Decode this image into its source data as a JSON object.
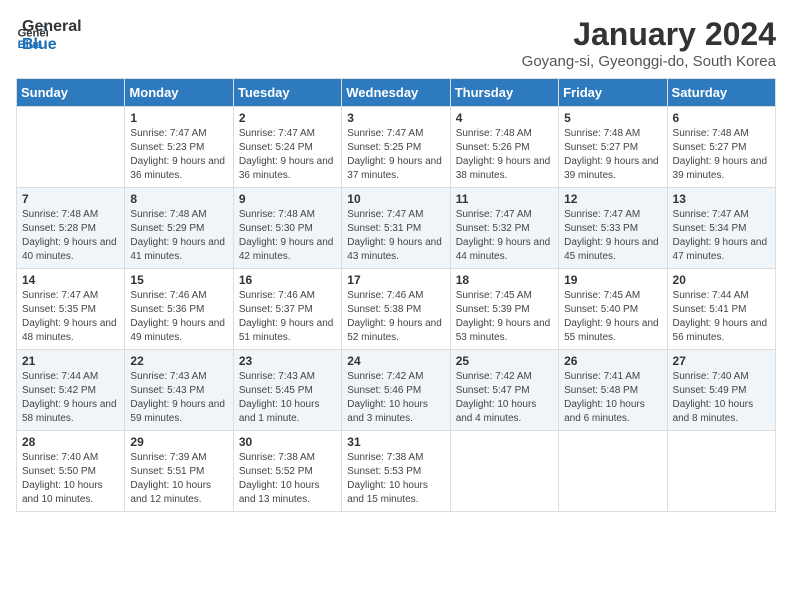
{
  "header": {
    "logo_general": "General",
    "logo_blue": "Blue",
    "month_year": "January 2024",
    "location": "Goyang-si, Gyeonggi-do, South Korea"
  },
  "days_of_week": [
    "Sunday",
    "Monday",
    "Tuesday",
    "Wednesday",
    "Thursday",
    "Friday",
    "Saturday"
  ],
  "weeks": [
    [
      {
        "day": "",
        "sunrise": "",
        "sunset": "",
        "daylight": ""
      },
      {
        "day": "1",
        "sunrise": "Sunrise: 7:47 AM",
        "sunset": "Sunset: 5:23 PM",
        "daylight": "Daylight: 9 hours and 36 minutes."
      },
      {
        "day": "2",
        "sunrise": "Sunrise: 7:47 AM",
        "sunset": "Sunset: 5:24 PM",
        "daylight": "Daylight: 9 hours and 36 minutes."
      },
      {
        "day": "3",
        "sunrise": "Sunrise: 7:47 AM",
        "sunset": "Sunset: 5:25 PM",
        "daylight": "Daylight: 9 hours and 37 minutes."
      },
      {
        "day": "4",
        "sunrise": "Sunrise: 7:48 AM",
        "sunset": "Sunset: 5:26 PM",
        "daylight": "Daylight: 9 hours and 38 minutes."
      },
      {
        "day": "5",
        "sunrise": "Sunrise: 7:48 AM",
        "sunset": "Sunset: 5:27 PM",
        "daylight": "Daylight: 9 hours and 39 minutes."
      },
      {
        "day": "6",
        "sunrise": "Sunrise: 7:48 AM",
        "sunset": "Sunset: 5:27 PM",
        "daylight": "Daylight: 9 hours and 39 minutes."
      }
    ],
    [
      {
        "day": "7",
        "sunrise": "Sunrise: 7:48 AM",
        "sunset": "Sunset: 5:28 PM",
        "daylight": "Daylight: 9 hours and 40 minutes."
      },
      {
        "day": "8",
        "sunrise": "Sunrise: 7:48 AM",
        "sunset": "Sunset: 5:29 PM",
        "daylight": "Daylight: 9 hours and 41 minutes."
      },
      {
        "day": "9",
        "sunrise": "Sunrise: 7:48 AM",
        "sunset": "Sunset: 5:30 PM",
        "daylight": "Daylight: 9 hours and 42 minutes."
      },
      {
        "day": "10",
        "sunrise": "Sunrise: 7:47 AM",
        "sunset": "Sunset: 5:31 PM",
        "daylight": "Daylight: 9 hours and 43 minutes."
      },
      {
        "day": "11",
        "sunrise": "Sunrise: 7:47 AM",
        "sunset": "Sunset: 5:32 PM",
        "daylight": "Daylight: 9 hours and 44 minutes."
      },
      {
        "day": "12",
        "sunrise": "Sunrise: 7:47 AM",
        "sunset": "Sunset: 5:33 PM",
        "daylight": "Daylight: 9 hours and 45 minutes."
      },
      {
        "day": "13",
        "sunrise": "Sunrise: 7:47 AM",
        "sunset": "Sunset: 5:34 PM",
        "daylight": "Daylight: 9 hours and 47 minutes."
      }
    ],
    [
      {
        "day": "14",
        "sunrise": "Sunrise: 7:47 AM",
        "sunset": "Sunset: 5:35 PM",
        "daylight": "Daylight: 9 hours and 48 minutes."
      },
      {
        "day": "15",
        "sunrise": "Sunrise: 7:46 AM",
        "sunset": "Sunset: 5:36 PM",
        "daylight": "Daylight: 9 hours and 49 minutes."
      },
      {
        "day": "16",
        "sunrise": "Sunrise: 7:46 AM",
        "sunset": "Sunset: 5:37 PM",
        "daylight": "Daylight: 9 hours and 51 minutes."
      },
      {
        "day": "17",
        "sunrise": "Sunrise: 7:46 AM",
        "sunset": "Sunset: 5:38 PM",
        "daylight": "Daylight: 9 hours and 52 minutes."
      },
      {
        "day": "18",
        "sunrise": "Sunrise: 7:45 AM",
        "sunset": "Sunset: 5:39 PM",
        "daylight": "Daylight: 9 hours and 53 minutes."
      },
      {
        "day": "19",
        "sunrise": "Sunrise: 7:45 AM",
        "sunset": "Sunset: 5:40 PM",
        "daylight": "Daylight: 9 hours and 55 minutes."
      },
      {
        "day": "20",
        "sunrise": "Sunrise: 7:44 AM",
        "sunset": "Sunset: 5:41 PM",
        "daylight": "Daylight: 9 hours and 56 minutes."
      }
    ],
    [
      {
        "day": "21",
        "sunrise": "Sunrise: 7:44 AM",
        "sunset": "Sunset: 5:42 PM",
        "daylight": "Daylight: 9 hours and 58 minutes."
      },
      {
        "day": "22",
        "sunrise": "Sunrise: 7:43 AM",
        "sunset": "Sunset: 5:43 PM",
        "daylight": "Daylight: 9 hours and 59 minutes."
      },
      {
        "day": "23",
        "sunrise": "Sunrise: 7:43 AM",
        "sunset": "Sunset: 5:45 PM",
        "daylight": "Daylight: 10 hours and 1 minute."
      },
      {
        "day": "24",
        "sunrise": "Sunrise: 7:42 AM",
        "sunset": "Sunset: 5:46 PM",
        "daylight": "Daylight: 10 hours and 3 minutes."
      },
      {
        "day": "25",
        "sunrise": "Sunrise: 7:42 AM",
        "sunset": "Sunset: 5:47 PM",
        "daylight": "Daylight: 10 hours and 4 minutes."
      },
      {
        "day": "26",
        "sunrise": "Sunrise: 7:41 AM",
        "sunset": "Sunset: 5:48 PM",
        "daylight": "Daylight: 10 hours and 6 minutes."
      },
      {
        "day": "27",
        "sunrise": "Sunrise: 7:40 AM",
        "sunset": "Sunset: 5:49 PM",
        "daylight": "Daylight: 10 hours and 8 minutes."
      }
    ],
    [
      {
        "day": "28",
        "sunrise": "Sunrise: 7:40 AM",
        "sunset": "Sunset: 5:50 PM",
        "daylight": "Daylight: 10 hours and 10 minutes."
      },
      {
        "day": "29",
        "sunrise": "Sunrise: 7:39 AM",
        "sunset": "Sunset: 5:51 PM",
        "daylight": "Daylight: 10 hours and 12 minutes."
      },
      {
        "day": "30",
        "sunrise": "Sunrise: 7:38 AM",
        "sunset": "Sunset: 5:52 PM",
        "daylight": "Daylight: 10 hours and 13 minutes."
      },
      {
        "day": "31",
        "sunrise": "Sunrise: 7:38 AM",
        "sunset": "Sunset: 5:53 PM",
        "daylight": "Daylight: 10 hours and 15 minutes."
      },
      {
        "day": "",
        "sunrise": "",
        "sunset": "",
        "daylight": ""
      },
      {
        "day": "",
        "sunrise": "",
        "sunset": "",
        "daylight": ""
      },
      {
        "day": "",
        "sunrise": "",
        "sunset": "",
        "daylight": ""
      }
    ]
  ]
}
